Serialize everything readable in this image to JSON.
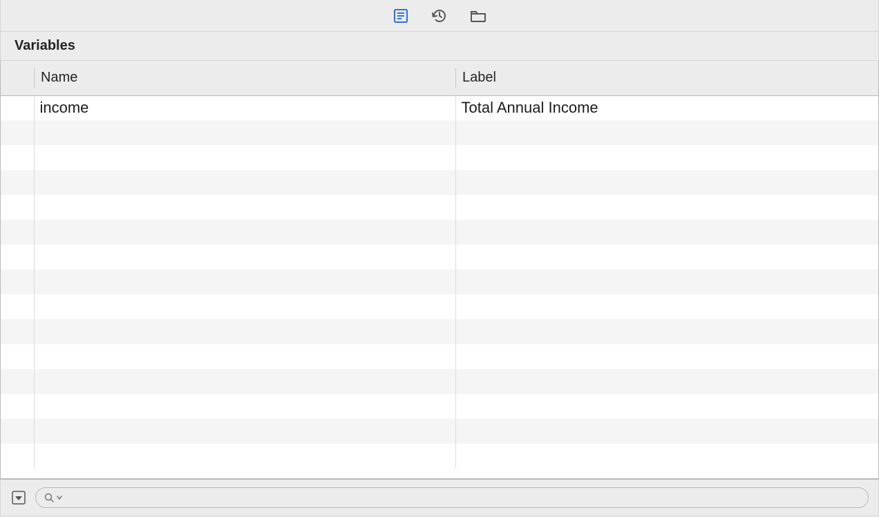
{
  "section_title": "Variables",
  "columns": {
    "name": "Name",
    "label": "Label"
  },
  "rows": [
    {
      "name": "income",
      "label": "Total Annual Income"
    }
  ],
  "blank_row_count": 14,
  "search": {
    "placeholder": ""
  }
}
